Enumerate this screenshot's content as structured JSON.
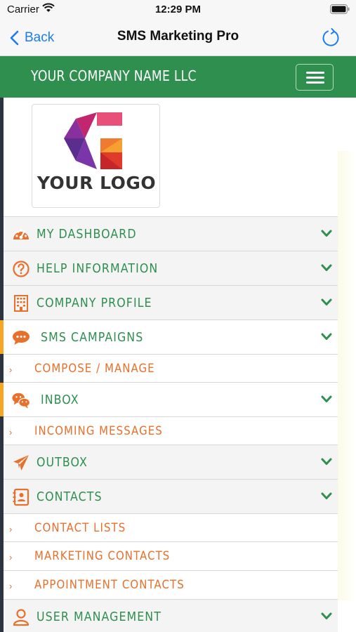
{
  "status_bar": {
    "carrier": "Carrier",
    "time": "12:29 PM"
  },
  "nav": {
    "back_label": "Back",
    "title": "SMS Marketing Pro"
  },
  "header": {
    "company_name": "YOUR COMPANY NAME LLC"
  },
  "logo": {
    "text": "YOUR LOGO"
  },
  "colors": {
    "brand_green": "#2e8f4f",
    "accent_orange": "#e8702a",
    "ios_blue": "#1b7cf2",
    "active_marker": "#f6a623"
  },
  "menu": {
    "dashboard": {
      "label": "MY DASHBOARD",
      "icon": "dashboard-gauge-icon"
    },
    "help": {
      "label": "HELP INFORMATION",
      "icon": "question-circle-icon"
    },
    "company": {
      "label": "COMPANY PROFILE",
      "icon": "building-icon"
    },
    "sms": {
      "label": "SMS CAMPAIGNS",
      "icon": "chat-bubble-icon",
      "sub": [
        "COMPOSE / MANAGE"
      ]
    },
    "inbox": {
      "label": "INBOX",
      "icon": "wechat-bubbles-icon",
      "sub": [
        "INCOMING MESSAGES"
      ]
    },
    "outbox": {
      "label": "OUTBOX",
      "icon": "paper-plane-icon"
    },
    "contacts": {
      "label": "CONTACTS",
      "icon": "address-book-icon",
      "sub": [
        "CONTACT LISTS",
        "MARKETING CONTACTS",
        "APPOINTMENT CONTACTS"
      ]
    },
    "users": {
      "label": "USER MANAGEMENT",
      "icon": "user-icon"
    }
  }
}
